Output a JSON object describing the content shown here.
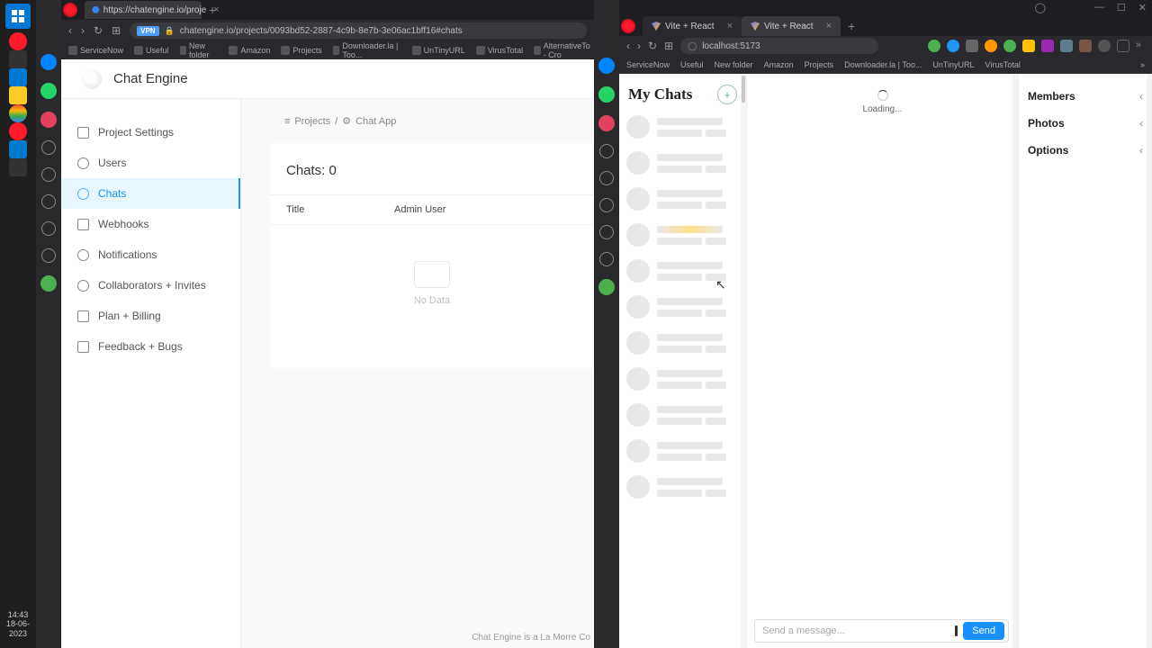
{
  "taskbar": {
    "time": "14:43",
    "date": "18-06-2023"
  },
  "left_window": {
    "tab_title": "https://chatengine.io/proje",
    "url": "chatengine.io/projects/0093bd52-2887-4c9b-8e7b-3e06ac1bff16#chats",
    "vpn": "VPN",
    "bookmarks": [
      "ServiceNow",
      "Useful",
      "New folder",
      "Amazon",
      "Projects",
      "Downloader.la | Too...",
      "UnTinyURL",
      "VirusTotal",
      "AlternativeTo - Cro"
    ]
  },
  "chatengine": {
    "brand": "Chat Engine",
    "nav": [
      {
        "label": "Project Settings"
      },
      {
        "label": "Users"
      },
      {
        "label": "Chats"
      },
      {
        "label": "Webhooks"
      },
      {
        "label": "Notifications"
      },
      {
        "label": "Collaborators + Invites"
      },
      {
        "label": "Plan + Billing"
      },
      {
        "label": "Feedback + Bugs"
      }
    ],
    "breadcrumb": {
      "root": "Projects",
      "sep": "/",
      "current": "Chat App"
    },
    "card_title": "Chats: 0",
    "columns": {
      "title": "Title",
      "admin": "Admin User"
    },
    "nodata": "No Data",
    "footer": "Chat Engine is a La Morre Co"
  },
  "right_window": {
    "tabs": [
      {
        "title": "Vite + React"
      },
      {
        "title": "Vite + React"
      }
    ],
    "url": "localhost:5173",
    "bookmarks": [
      "ServiceNow",
      "Useful",
      "New folder",
      "Amazon",
      "Projects",
      "Downloader.la | Too...",
      "UnTinyURL",
      "VirusTotal"
    ]
  },
  "chatapp": {
    "heading": "My Chats",
    "add": "+",
    "loading": "Loading...",
    "placeholder": "Send a message...",
    "send": "Send",
    "sections": {
      "members": "Members",
      "photos": "Photos",
      "options": "Options"
    }
  },
  "win_controls": {
    "min": "—",
    "max": "☐",
    "close": "✕"
  }
}
